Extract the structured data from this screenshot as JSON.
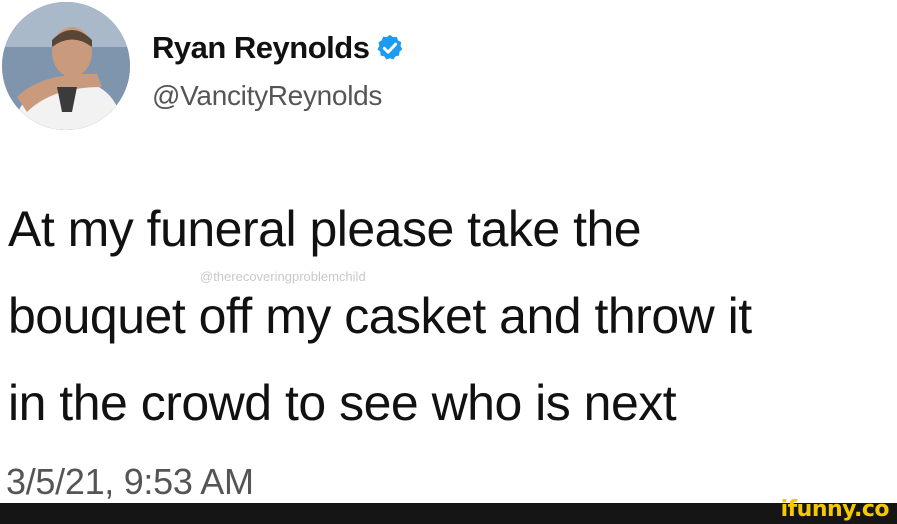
{
  "author": {
    "display_name": "Ryan Reynolds",
    "handle": "@VancityReynolds",
    "verified": true,
    "avatar_icon": "profile-photo"
  },
  "tweet": {
    "lines": [
      "At my funeral please take the",
      "bouquet off my casket and throw it",
      "in the crowd to see who is next"
    ],
    "timestamp": "3/5/21, 9:53 AM"
  },
  "watermark": {
    "text": "@therecoveringproblemchild"
  },
  "branding": {
    "logo_text": "ifunny.co",
    "logo_color": "#f5c800",
    "footer_color": "#151515"
  },
  "colors": {
    "verified_badge": "#1d9bf0",
    "handle": "#555555",
    "text": "#111111"
  }
}
